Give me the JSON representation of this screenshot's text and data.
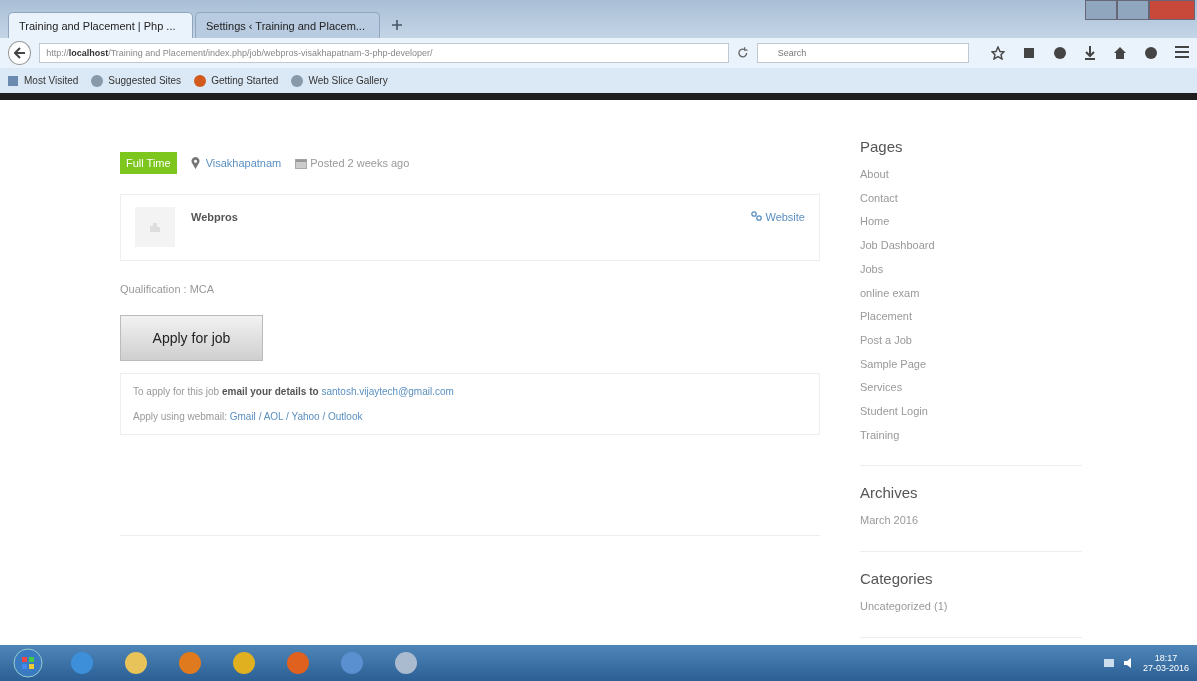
{
  "browser": {
    "tabs": [
      {
        "label": "Training and Placement | Php ...",
        "selected": true
      },
      {
        "label": "Settings ‹ Training and Placem...",
        "selected": false
      }
    ],
    "address": "http://**localhost**/Training and Placement/index.php/job/webpros-visakhapatnam-3-php-developer/",
    "search": {
      "placeholder": "Search"
    },
    "bookmarks": [
      "Most Visited",
      "Suggested Sites",
      "Getting Started",
      "Web Slice Gallery"
    ]
  },
  "job": {
    "type": "Full Time",
    "location": "Visakhapatnam",
    "posted": "Posted 2 weeks ago",
    "company": "Webpros",
    "website": "Website",
    "qualification": "Qualification : MCA",
    "apply_button": "Apply for job",
    "apply_text": "To apply for this job **email your details to**",
    "email": "santosh.vijaytech@gmail.com",
    "webmail_label": "Apply using webmail:",
    "webmail_links": [
      "Gmail",
      "AOL",
      "Yahoo",
      "Outlook"
    ],
    "link_separator": "/"
  },
  "sidebar": [
    {
      "title": "Pages",
      "items": [
        "About",
        "Contact",
        "Home",
        "Job Dashboard",
        "Jobs",
        "online exam",
        "Placement",
        "Post a Job",
        "Sample Page",
        "Services",
        "Student Login",
        "Training"
      ]
    },
    {
      "title": "Archives",
      "items": [
        "March 2016"
      ]
    },
    {
      "title": "Categories",
      "items": [
        "Uncategorized (1)"
      ]
    }
  ],
  "taskbar": {
    "time": "18:17",
    "date": "27-03-2016"
  }
}
